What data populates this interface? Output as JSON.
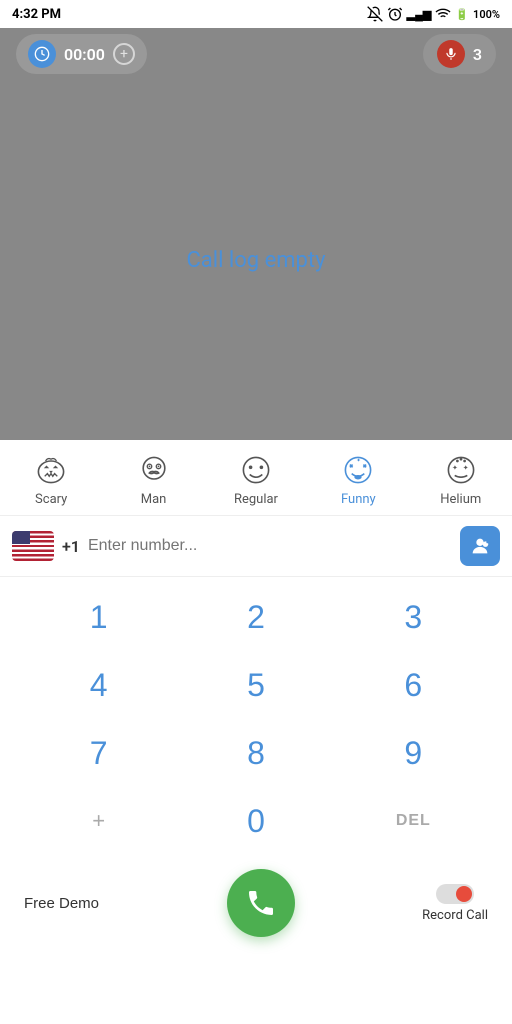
{
  "statusBar": {
    "time": "4:32 PM",
    "battery": "100%"
  },
  "topBar": {
    "timerValue": "00:00",
    "micCount": "3"
  },
  "callLog": {
    "emptyMessage": "Call log empty"
  },
  "voiceFilters": [
    {
      "id": "scary",
      "label": "Scary",
      "active": false
    },
    {
      "id": "man",
      "label": "Man",
      "active": false
    },
    {
      "id": "regular",
      "label": "Regular",
      "active": false
    },
    {
      "id": "funny",
      "label": "Funny",
      "active": true
    },
    {
      "id": "helium",
      "label": "Helium",
      "active": false
    }
  ],
  "dialerInput": {
    "countryCode": "+1",
    "placeholder": "Enter number..."
  },
  "keypad": {
    "rows": [
      [
        "1",
        "2",
        "3"
      ],
      [
        "4",
        "5",
        "6"
      ],
      [
        "7",
        "8",
        "9"
      ],
      [
        "+",
        "0",
        "DEL"
      ]
    ]
  },
  "actionBar": {
    "freeDemoLabel": "Free Demo",
    "recordCallLabel": "Record Call"
  }
}
